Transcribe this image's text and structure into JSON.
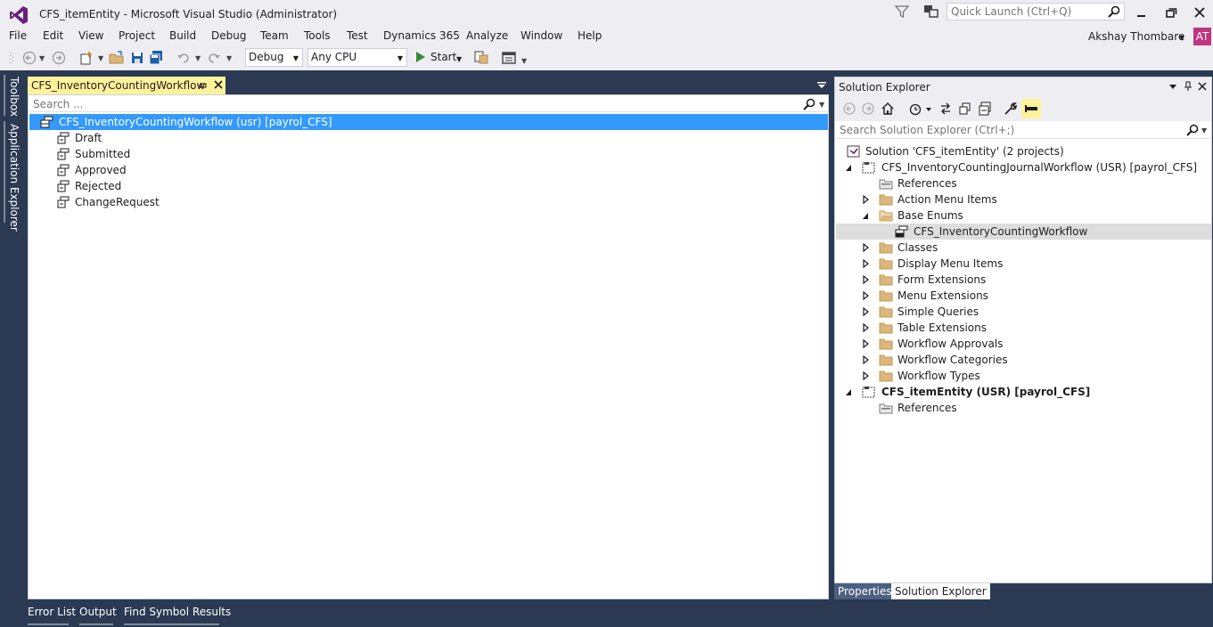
{
  "window": {
    "title": "CFS_itemEntity - Microsoft Visual Studio (Administrator)",
    "quick_launch_placeholder": "Quick Launch (Ctrl+Q)",
    "user_name": "Akshay Thombare",
    "avatar_initials": "AT",
    "accent_color": "#68217a",
    "avatar_color": "#c1347f"
  },
  "menu": [
    "File",
    "Edit",
    "View",
    "Project",
    "Build",
    "Debug",
    "Team",
    "Tools",
    "Test",
    "Dynamics 365",
    "Analyze",
    "Window",
    "Help"
  ],
  "toolbar": {
    "configuration": "Debug",
    "platform": "Any CPU",
    "start_label": "Start"
  },
  "side_tabs": [
    "Toolbox",
    "Application Explorer"
  ],
  "document": {
    "tab_title": "CFS_InventoryCountingWorkflow",
    "search_placeholder": "Search ...",
    "root_label": "CFS_InventoryCountingWorkflow (usr) [payrol_CFS]",
    "enum_values": [
      "Draft",
      "Submitted",
      "Approved",
      "Rejected",
      "ChangeRequest"
    ],
    "tab_color": "#fff29d",
    "selection_color": "#3399ff"
  },
  "solution_explorer": {
    "title": "Solution Explorer",
    "search_placeholder": "Search Solution Explorer (Ctrl+;)",
    "solution_label": "Solution 'CFS_itemEntity' (2 projects)",
    "project1": {
      "label": "CFS_InventoryCountingJournalWorkflow (USR) [payrol_CFS]",
      "references": "References",
      "action_menu_items": "Action Menu Items",
      "base_enums": "Base Enums",
      "base_enum_item": "CFS_InventoryCountingWorkflow",
      "folders": [
        "Classes",
        "Display Menu Items",
        "Form Extensions",
        "Menu Extensions",
        "Simple Queries",
        "Table Extensions",
        "Workflow Approvals",
        "Workflow Categories",
        "Workflow Types"
      ]
    },
    "project2": {
      "label": "CFS_itemEntity (USR) [payrol_CFS]",
      "references": "References"
    },
    "bottom_tabs": [
      "Properties",
      "Solution Explorer"
    ]
  },
  "bottom_tabs": [
    "Error List",
    "Output",
    "Find Symbol Results"
  ]
}
